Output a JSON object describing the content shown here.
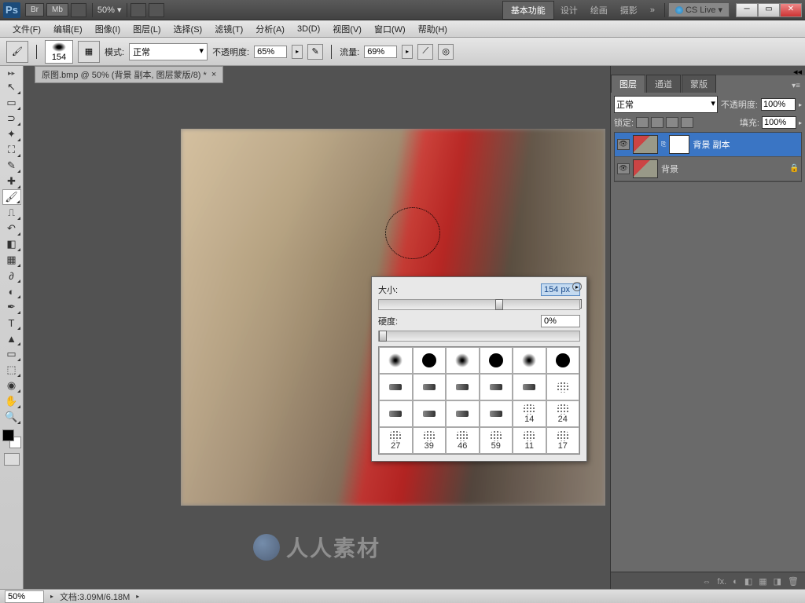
{
  "topbar": {
    "br": "Br",
    "mb": "Mb",
    "zoom": "50%",
    "workspace_active": "基本功能",
    "ws_links": [
      "设计",
      "绘画",
      "摄影",
      "»"
    ],
    "cslive": "CS Live"
  },
  "menu": {
    "items": [
      "文件(F)",
      "编辑(E)",
      "图像(I)",
      "图层(L)",
      "选择(S)",
      "滤镜(T)",
      "分析(A)",
      "3D(D)",
      "视图(V)",
      "窗口(W)",
      "帮助(H)"
    ]
  },
  "options": {
    "brush_size_label": "154",
    "mode_label": "模式:",
    "mode_value": "正常",
    "opacity_label": "不透明度:",
    "opacity_value": "65%",
    "flow_label": "流量:",
    "flow_value": "69%"
  },
  "document": {
    "tab_title": "原图.bmp @ 50% (背景 副本, 图层蒙版/8) *"
  },
  "brush_popup": {
    "size_label": "大小:",
    "size_value": "154 px",
    "hardness_label": "硬度:",
    "hardness_value": "0%",
    "size_pct": 58,
    "hard_pct": 0,
    "presets": [
      {
        "t": "soft"
      },
      {
        "t": "hard"
      },
      {
        "t": "soft"
      },
      {
        "t": "hard"
      },
      {
        "t": "soft"
      },
      {
        "t": "hard"
      },
      {
        "t": "s"
      },
      {
        "t": "s"
      },
      {
        "t": "s"
      },
      {
        "t": "s"
      },
      {
        "t": "s"
      },
      {
        "t": "sp",
        "n": ""
      },
      {
        "t": "s"
      },
      {
        "t": "s"
      },
      {
        "t": "s"
      },
      {
        "t": "s"
      },
      {
        "t": "sp",
        "n": "14"
      },
      {
        "t": "sp",
        "n": "24"
      },
      {
        "t": "sp",
        "n": "27"
      },
      {
        "t": "sp",
        "n": "39"
      },
      {
        "t": "sp",
        "n": "46"
      },
      {
        "t": "sp",
        "n": "59"
      },
      {
        "t": "sp",
        "n": "11"
      },
      {
        "t": "sp",
        "n": "17"
      }
    ]
  },
  "layers_panel": {
    "tabs": [
      "图层",
      "通道",
      "蒙版"
    ],
    "blend_mode": "正常",
    "opacity_label": "不透明度:",
    "opacity_value": "100%",
    "lock_label": "锁定:",
    "fill_label": "填充:",
    "fill_value": "100%",
    "layers": [
      {
        "name": "背景 副本",
        "selected": true,
        "has_mask": true,
        "locked": false
      },
      {
        "name": "背景",
        "selected": false,
        "has_mask": false,
        "locked": true
      }
    ],
    "footer_icons": [
      "⇔",
      "fx.",
      "◐",
      "◧",
      "▦",
      "◨",
      "🗑"
    ]
  },
  "status": {
    "zoom": "50%",
    "doc_info": "文档:3.09M/6.18M"
  },
  "watermark": "人人素材"
}
